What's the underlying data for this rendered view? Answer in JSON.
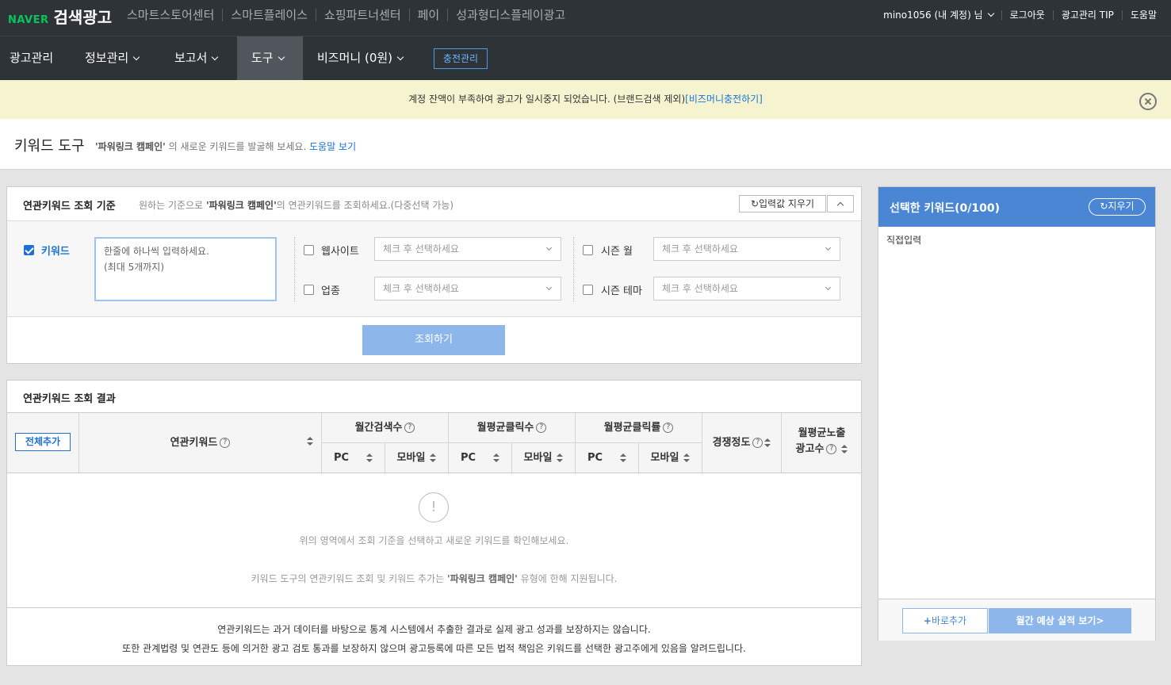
{
  "topbar": {
    "logo_naver": "NAVER",
    "logo_brand": "검색광고",
    "links": [
      "스마트스토어센터",
      "스마트플레이스",
      "쇼핑파트너센터",
      "페이",
      "성과형디스플레이광고"
    ],
    "account": "mino1056 (내 계정) 님",
    "logout": "로그아웃",
    "tip": "광고관리 TIP",
    "help": "도움말"
  },
  "nav": {
    "items": [
      "광고관리",
      "정보관리",
      "보고서",
      "도구",
      "비즈머니 (0원)"
    ],
    "active": "도구",
    "charge": "충전관리"
  },
  "notice": {
    "text": "계정 잔액이 부족하여 광고가 일시중지 되었습니다. (브랜드검색 제외)",
    "link": "[비즈머니충전하기]"
  },
  "title": {
    "heading": "키워드 도구",
    "campaign": "'파워링크 캠페인'",
    "desc": "의 새로운 키워드를 발굴해 보세요.",
    "help_link": "도움말 보기"
  },
  "criteria": {
    "heading": "연관키워드 조회 기준",
    "desc_pre": "원하는 기준으로",
    "desc_campaign": "'파워링크 캠페인'",
    "desc_post": "의 연관키워드를 조회하세요.(다중선택 가능)",
    "clear_label": "입력값 지우기",
    "keyword_label": "키워드",
    "keyword_placeholder_line1": "한줄에 하나씩 입력하세요.",
    "keyword_placeholder_line2": "(최대 5개까지)",
    "website_label": "웹사이트",
    "industry_label": "업종",
    "season_month_label": "시즌 월",
    "season_theme_label": "시즌 테마",
    "select_placeholder": "체크 후 선택하세요",
    "search_button": "조회하기"
  },
  "results": {
    "heading": "연관키워드 조회 결과",
    "add_all": "전체추가",
    "col_keyword": "연관키워드",
    "col_monthly_search": "월간검색수",
    "col_avg_clicks": "월평균클릭수",
    "col_avg_ctr": "월평균클릭률",
    "col_competition": "경쟁정도",
    "col_ad_count_line1": "월평균노출",
    "col_ad_count_line2": "광고수",
    "sub_pc": "PC",
    "sub_mobile": "모바일",
    "empty_msg": "위의 영역에서 조회 기준을 선택하고 새로운 키워드를 확인해보세요.",
    "scope_pre": "키워드 도구의 연관키워드 조회 및 키워드 추가는",
    "scope_campaign": "'파워링크 캠페인'",
    "scope_post": "유형에 한해 지원됩니다.",
    "disclaimer_line1": "연관키워드는 과거 데이터를 바탕으로 통계 시스템에서 추출한 결과로 실제 광고 성과를 보장하지는 않습니다.",
    "disclaimer_line2": "또한 관계법령 및 연관도 등에 의거한 광고 검토 통과를 보장하지 않으며 광고등록에 따른 모든 법적 책임은 키워드를 선택한 광고주에게 있음을 알려드립니다."
  },
  "selected": {
    "heading": "선택한 키워드(0/100)",
    "reset": "지우기",
    "direct_input": "직접입력",
    "quick_add": "바로추가",
    "forecast": "월간 예상 실적 보기"
  }
}
